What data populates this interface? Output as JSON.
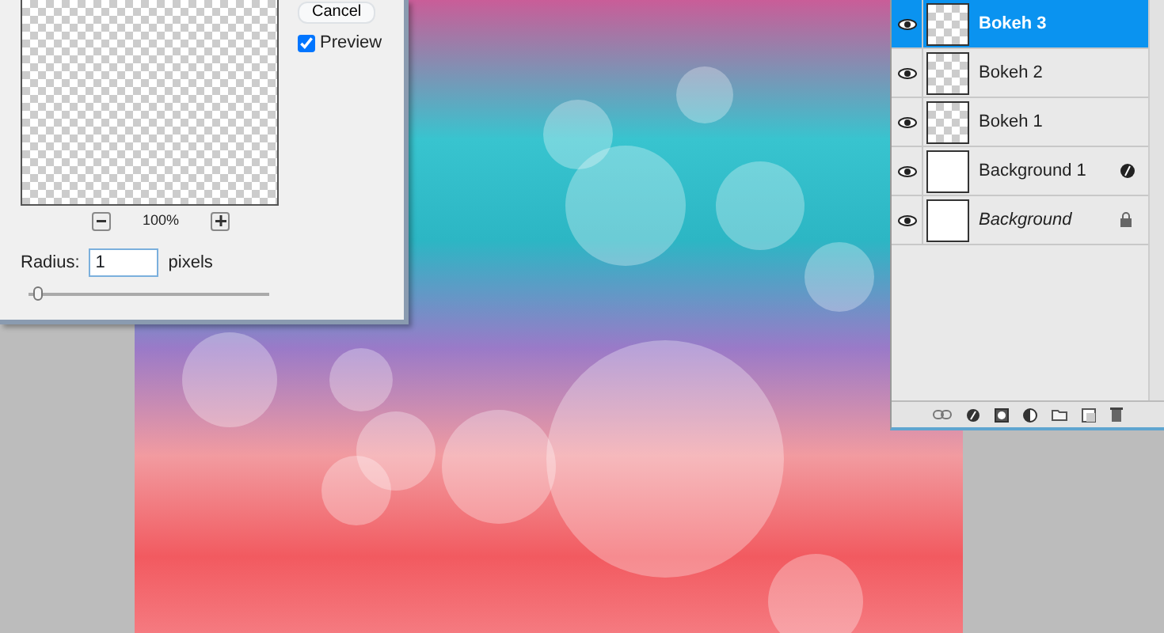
{
  "filter_dialog": {
    "cancel_button": "Cancel",
    "preview": {
      "label": "Preview",
      "checked": true
    },
    "zoom_level": "100%",
    "radius": {
      "label": "Radius:",
      "value": "1",
      "unit": "pixels",
      "level": 0.04
    }
  },
  "layers_panel": {
    "layers": [
      {
        "name": "Bokeh 3",
        "selected": true,
        "visible": true,
        "kind": "transparent"
      },
      {
        "name": "Bokeh 2",
        "selected": false,
        "visible": true,
        "kind": "transparent"
      },
      {
        "name": "Bokeh 1",
        "selected": false,
        "visible": true,
        "kind": "transparent"
      },
      {
        "name": "Background 1",
        "selected": false,
        "visible": true,
        "kind": "smart"
      },
      {
        "name": "Background",
        "selected": false,
        "visible": true,
        "kind": "locked"
      }
    ]
  }
}
